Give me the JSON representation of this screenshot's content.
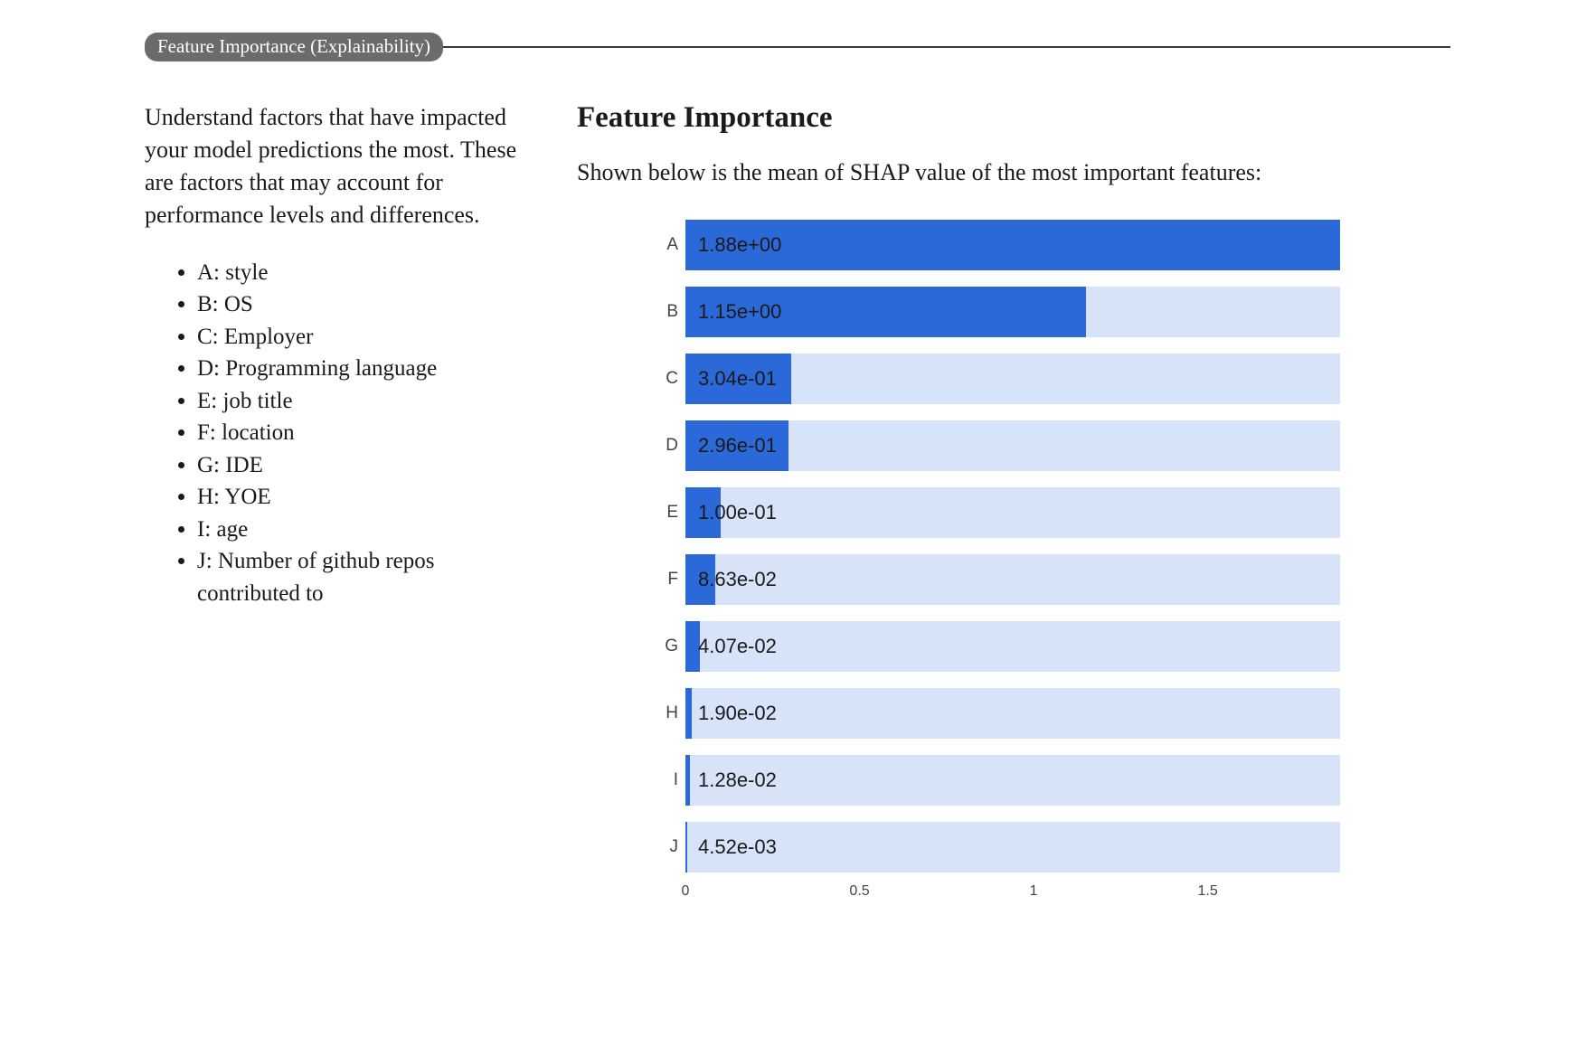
{
  "section_label": "Feature Importance (Explainability)",
  "intro": "Understand factors that have impacted your model predictions the most. These are factors that may account for performance levels and differences.",
  "legend": [
    "A: style",
    "B: OS",
    "C: Employer",
    "D: Programming language",
    "E: job title",
    "F: location",
    "G: IDE",
    "H: YOE",
    "I: age",
    "J: Number of github repos contributed to"
  ],
  "right_heading": "Feature Importance",
  "right_sub": "Shown below is the mean of SHAP value of the most important features:",
  "chart_data": {
    "type": "bar",
    "orientation": "horizontal",
    "categories": [
      "A",
      "B",
      "C",
      "D",
      "E",
      "F",
      "G",
      "H",
      "I",
      "J"
    ],
    "values": [
      1.88,
      1.15,
      0.304,
      0.296,
      0.1,
      0.0863,
      0.0407,
      0.019,
      0.0128,
      0.00452
    ],
    "value_labels": [
      "1.88e+00",
      "1.15e+00",
      "3.04e-01",
      "2.96e-01",
      "1.00e-01",
      "8.63e-02",
      "4.07e-02",
      "1.90e-02",
      "1.28e-02",
      "4.52e-03"
    ],
    "x_ticks": [
      0,
      0.5,
      1,
      1.5
    ],
    "xlim": [
      0,
      1.88
    ],
    "bar_color": "#2b68d8",
    "track_color": "#d7e3f8",
    "title": "",
    "xlabel": "",
    "ylabel": ""
  }
}
